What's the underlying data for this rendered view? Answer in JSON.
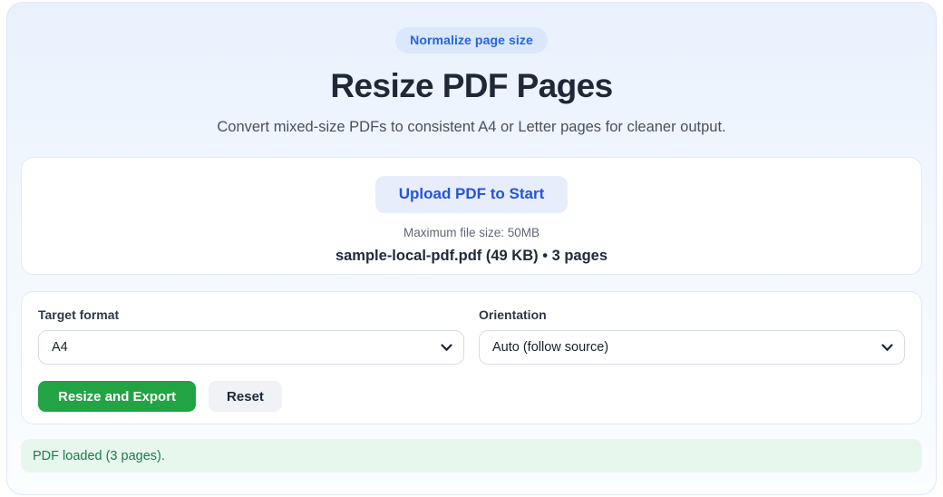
{
  "badge": {
    "label": "Normalize page size"
  },
  "header": {
    "title": "Resize PDF Pages",
    "subtitle": "Convert mixed-size PDFs to consistent A4 or Letter pages for cleaner output."
  },
  "upload_card": {
    "upload_button_label": "Upload PDF to Start",
    "max_size_note": "Maximum file size: 50MB",
    "file_info": "sample-local-pdf.pdf (49 KB) • 3 pages"
  },
  "options_card": {
    "target_format": {
      "label": "Target format",
      "value": "A4"
    },
    "orientation": {
      "label": "Orientation",
      "value": "Auto (follow source)"
    },
    "resize_button_label": "Resize and Export",
    "reset_button_label": "Reset"
  },
  "status": {
    "message": "PDF loaded (3 pages)."
  },
  "colors": {
    "accent_blue": "#2563eb",
    "badge_bg": "#dbe7fa",
    "upload_button_bg": "#e7edfb",
    "upload_button_text": "#2553de",
    "primary_green": "#22a344",
    "status_bg": "#e7f7ee",
    "status_text": "#1b7c49"
  }
}
